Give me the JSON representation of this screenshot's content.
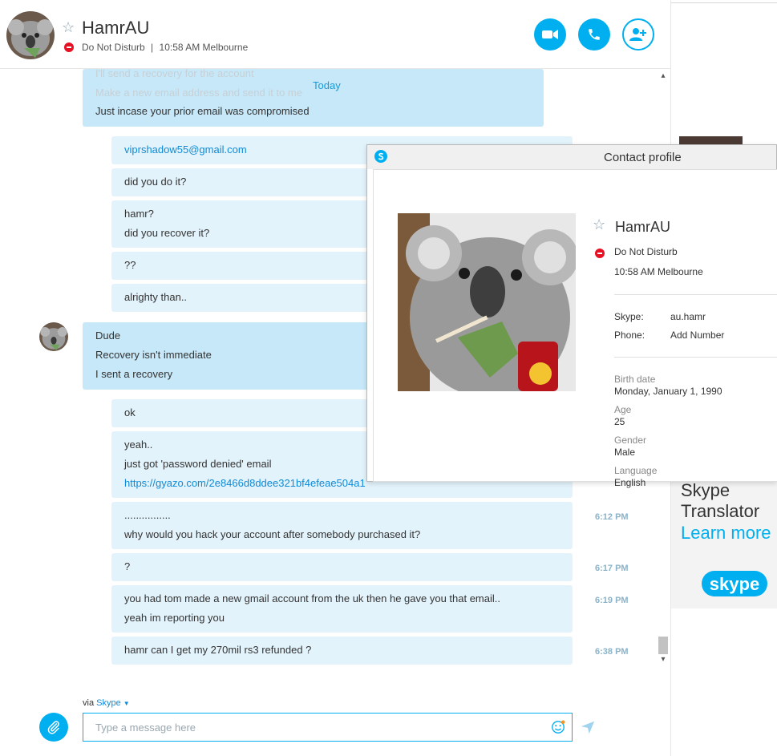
{
  "header": {
    "name": "HamrAU",
    "status": "Do Not Disturb",
    "local_time": "10:58 AM Melbourne",
    "separator": "|"
  },
  "chat": {
    "day_label": "Today",
    "faded_lines": [
      "I'll send a recovery for the account",
      "Make a new email address and send it to me"
    ],
    "messages": [
      {
        "from": "them",
        "lines": [
          "Just incase your prior email was compromised"
        ]
      },
      {
        "from": "me",
        "lines": [
          "viprshadow55@gmail.com"
        ]
      },
      {
        "from": "me",
        "lines": [
          "did you do it?"
        ]
      },
      {
        "from": "me",
        "lines": [
          "hamr?",
          "did you recover it?"
        ]
      },
      {
        "from": "me",
        "lines": [
          "??"
        ]
      },
      {
        "from": "me",
        "lines": [
          "alrighty than.."
        ]
      },
      {
        "from": "them",
        "lines": [
          "Dude",
          "Recovery isn't immediate",
          "I sent a recovery"
        ]
      },
      {
        "from": "me",
        "lines": [
          "ok"
        ]
      },
      {
        "from": "me",
        "lines": [
          "yeah..",
          "just got 'password denied' email",
          "https://gyazo.com/2e8466d8ddee321bf4efeae504a1"
        ]
      },
      {
        "from": "me",
        "lines": [
          "................",
          "why would you hack your account after somebody purchased it?"
        ],
        "time": "6:12 PM"
      },
      {
        "from": "me",
        "lines": [
          "?"
        ],
        "time": "6:17 PM"
      },
      {
        "from": "me",
        "lines": [
          "you had tom made a new gmail account from the uk then he gave you that email..",
          "yeah im reporting you"
        ],
        "time": "6:19 PM"
      },
      {
        "from": "me",
        "lines": [
          "hamr can I get my 270mil rs3 refunded ?"
        ],
        "time": "6:38 PM"
      }
    ]
  },
  "compose": {
    "via": "via",
    "via_service": "Skype",
    "placeholder": "Type a message here"
  },
  "profile": {
    "title": "Contact profile",
    "name": "HamrAU",
    "status": "Do Not Disturb",
    "local_time": "10:58 AM Melbourne",
    "skype_label": "Skype:",
    "skype_value": "au.hamr",
    "phone_label": "Phone:",
    "phone_value": "Add Number",
    "birth_label": "Birth date",
    "birth_value": "Monday, January 1, 1990",
    "age_label": "Age",
    "age_value": "25",
    "gender_label": "Gender",
    "gender_value": "Male",
    "language_label": "Language",
    "language_value": "English"
  },
  "ad": {
    "line1": "Skype",
    "line2": "Translator",
    "line3": "Learn more",
    "logo_text": "skype"
  },
  "colors": {
    "accent": "#00aff0",
    "bubble_me": "#e3f3fb",
    "bubble_them": "#c7e8f8",
    "dnd": "#e81123",
    "link": "#0f8ad6"
  },
  "icons": [
    "star-icon",
    "video-call-icon",
    "phone-icon",
    "add-contact-icon",
    "paperclip-icon",
    "emoji-icon",
    "send-icon",
    "skype-logo-icon",
    "dnd-status-icon"
  ]
}
